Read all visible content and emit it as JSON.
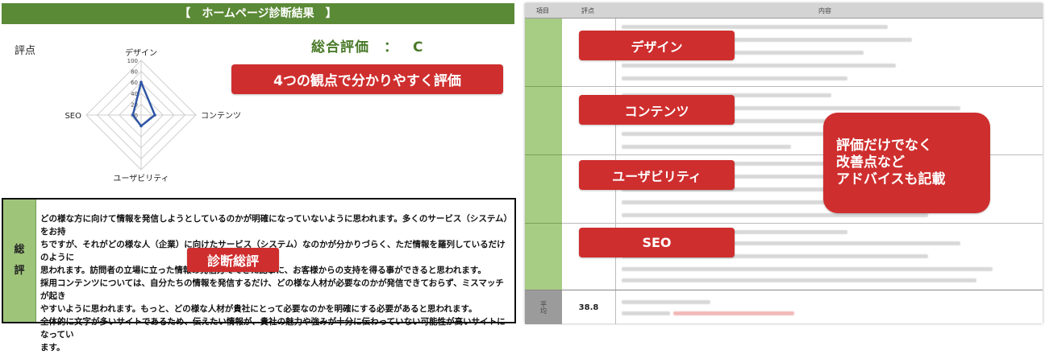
{
  "report": {
    "title": "【　ホームページ診断結果　】",
    "score_label": "評点",
    "overall_label": "総合評価",
    "overall_sep": "：",
    "overall_grade": "C"
  },
  "radar": {
    "axes": [
      "デザイン",
      "コンテンツ",
      "ユーザビリティ",
      "SEO"
    ],
    "ticks": [
      "100",
      "80",
      "60",
      "40",
      "20",
      "0"
    ],
    "values": [
      60,
      25,
      20,
      15
    ],
    "max": 100,
    "line_color": "#2f56a6"
  },
  "summary": {
    "side_label": [
      "総",
      "評"
    ],
    "lines": [
      "どの様な方に向けて情報を発信しようとしているのかが明確になっていないように思われます。多くのサービス（システム）をお持",
      "ちですが、それがどの様な人（企業）に向けたサービス（システム）なのかが分かりづらく、ただ情報を羅列しているだけのように",
      "思われます。訪問者の立場に立った情報の発信方でできた記事に、お客様からの支持を得る事ができると思われます。",
      "採用コンテンツについては、自分たちの情報を発信するだけ、どの様な人材が必要なのかが発信できておらず、ミスマッチが起き",
      "やすいように思われます。もっと、どの様な人材が貴社にとって必要なのかを明確にする必要があると思われます。",
      "全体的に文字が多いサイトであるため、伝えたい情報が、貴社の魅力や強みが十分に伝わっていない可能性が高いサイトになってい",
      "ます。"
    ]
  },
  "table": {
    "header": [
      "項目",
      "評点",
      "内容"
    ],
    "avg_label": "平均",
    "avg_score": "38.8"
  },
  "tags": {
    "evaluation": "4つの観点で分かりやすく評価",
    "summary": "診断総評",
    "design": "デザイン",
    "contents": "コンテンツ",
    "usability": "ユーザビリティ",
    "seo": "SEO",
    "advice_lines": [
      "評価だけでなく",
      "改善点など",
      "アドバイスも記載"
    ]
  },
  "colors": {
    "accent_green": "#5b8a36",
    "tag_red": "#cf2e2e",
    "table_green": "#a7cc84"
  }
}
